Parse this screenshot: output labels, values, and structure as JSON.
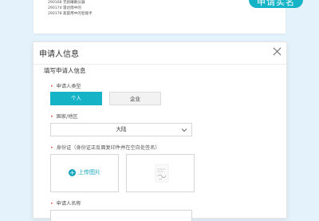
{
  "background": {
    "list_items": [
      "290168 无损睡眠仪器",
      "290174 雷达雨中的",
      "290178 家庭用中的智能手"
    ],
    "cta_label": "申请实名"
  },
  "modal": {
    "title": "申请人信息",
    "section_title": "填写申请人信息",
    "applicant_type": {
      "label": "申请人类型",
      "options": [
        "个人",
        "企业"
      ],
      "selected": "个人"
    },
    "country": {
      "label": "国家/地区",
      "value": "大陆"
    },
    "id_card": {
      "label": "身份证（身份证正反面复印件并在空白处签名）",
      "upload_label": "上传图片"
    },
    "applicant_name": {
      "label": "申请人名称"
    }
  },
  "colors": {
    "accent": "#14b3c6",
    "required": "#e23b3b",
    "background": "#e4f2fc"
  }
}
